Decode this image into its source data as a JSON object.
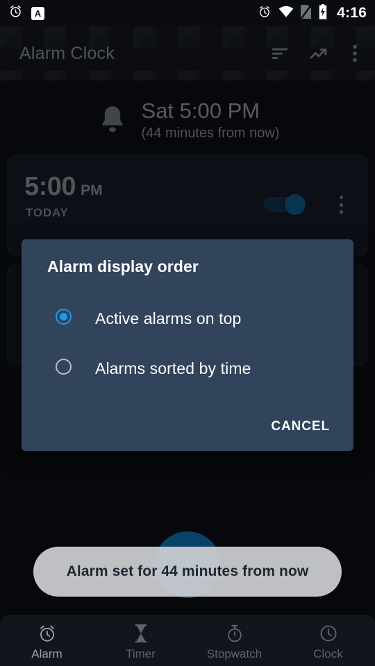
{
  "status_bar": {
    "time": "4:16",
    "left_icons": [
      {
        "name": "alarm-icon"
      },
      {
        "name": "app-notification-badge",
        "label": "A"
      }
    ],
    "right_icons": [
      {
        "name": "alarm-icon"
      },
      {
        "name": "wifi-icon"
      },
      {
        "name": "no-sim-icon"
      },
      {
        "name": "battery-charging-icon"
      }
    ]
  },
  "app_bar": {
    "title": "Alarm Clock",
    "actions": [
      {
        "name": "sort-icon"
      },
      {
        "name": "trending-up-icon"
      },
      {
        "name": "overflow-menu-icon"
      }
    ]
  },
  "upcoming": {
    "icon": "bell-icon",
    "primary": "Sat 5:00 PM",
    "secondary": "(44 minutes from now)"
  },
  "alarms": [
    {
      "time": "5:00",
      "ampm": "PM",
      "day": "TODAY",
      "enabled": true,
      "overflow_icon": "overflow-menu-icon"
    },
    {
      "time": "",
      "ampm": "",
      "day": "",
      "enabled": false,
      "overflow_icon": "overflow-menu-icon"
    }
  ],
  "dialog": {
    "title": "Alarm display order",
    "options": [
      {
        "label": "Active alarms on top",
        "selected": true
      },
      {
        "label": "Alarms sorted by time",
        "selected": false
      }
    ],
    "cancel_label": "CANCEL",
    "accent_color": "#1e9ae8",
    "background_color": "#32445c"
  },
  "fab": {
    "icon": "add-alarm-icon",
    "color": "#0a4168"
  },
  "toast": {
    "message": "Alarm set for 44 minutes from now"
  },
  "bottom_nav": {
    "items": [
      {
        "label": "Alarm",
        "icon": "alarm-clock-icon",
        "active": true
      },
      {
        "label": "Timer",
        "icon": "hourglass-icon",
        "active": false
      },
      {
        "label": "Stopwatch",
        "icon": "stopwatch-icon",
        "active": false
      },
      {
        "label": "Clock",
        "icon": "clock-icon",
        "active": false
      }
    ]
  }
}
